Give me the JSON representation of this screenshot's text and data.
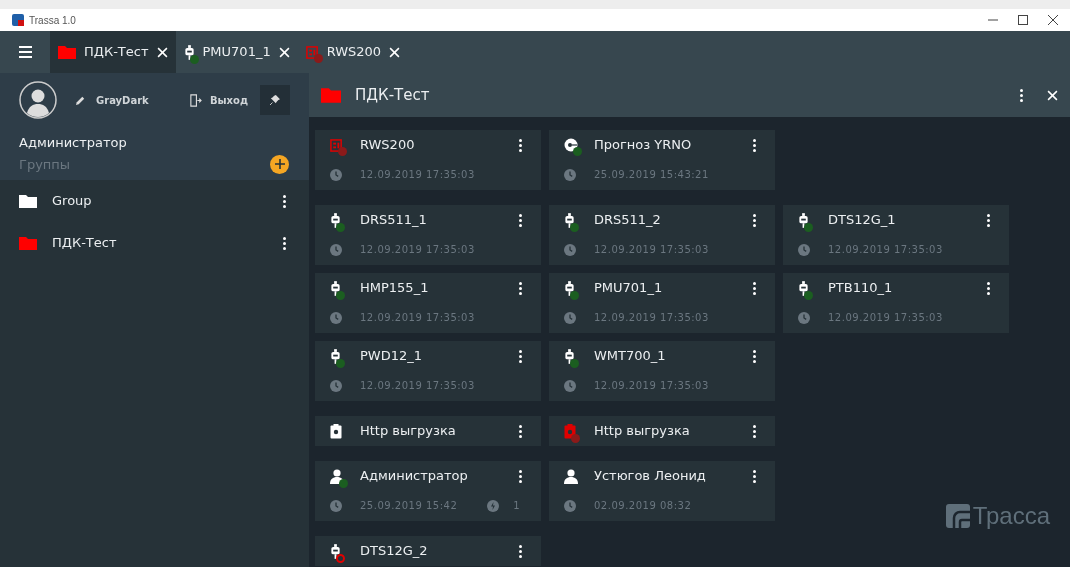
{
  "window": {
    "title": "Trassa 1.0"
  },
  "tabs": [
    {
      "label": "ПДК-Тест",
      "kind": "folder",
      "alarm": false,
      "selected": true
    },
    {
      "label": "PMU701_1",
      "kind": "device",
      "alarm": false,
      "color": "#1b5e20",
      "selected": false
    },
    {
      "label": "RWS200",
      "kind": "server",
      "alarm": true,
      "color": "#8b1a1a",
      "selected": false
    }
  ],
  "sidebar": {
    "theme": "GrayDark",
    "logout": "Выход",
    "pinned": true,
    "user": "Администратор",
    "groups_label": "Группы",
    "groups": [
      {
        "label": "Group",
        "color": "#ffffff"
      },
      {
        "label": "ПДК-Тест",
        "color": "#ff0000"
      }
    ]
  },
  "panel": {
    "title": "ПДК-Тест",
    "logo": "Трасса",
    "sections": [
      [
        {
          "kind": "server",
          "alarm": true,
          "disabled": false,
          "color": "#8b1a1a",
          "name": "RWS200",
          "time": "12.09.2019 17:35:03"
        },
        {
          "kind": "forecast",
          "alarm": false,
          "disabled": false,
          "color": "#1b5e20",
          "name": "Прогноз YRNO",
          "time": "25.09.2019 15:43:21"
        }
      ],
      [
        {
          "kind": "device",
          "alarm": false,
          "disabled": false,
          "color": "#1b5e20",
          "name": "DRS511_1",
          "time": "12.09.2019 17:35:03"
        },
        {
          "kind": "device",
          "alarm": false,
          "disabled": false,
          "color": "#1b5e20",
          "name": "DRS511_2",
          "time": "12.09.2019 17:35:03"
        },
        {
          "kind": "device",
          "alarm": false,
          "disabled": false,
          "color": "#1b5e20",
          "name": "DTS12G_1",
          "time": "12.09.2019 17:35:03"
        },
        {
          "kind": "device",
          "alarm": false,
          "disabled": false,
          "color": "#1b5e20",
          "name": "HMP155_1",
          "time": "12.09.2019 17:35:03"
        },
        {
          "kind": "device",
          "alarm": false,
          "disabled": false,
          "color": "#1b5e20",
          "name": "PMU701_1",
          "time": "12.09.2019 17:35:03"
        },
        {
          "kind": "device",
          "alarm": false,
          "disabled": false,
          "color": "#1b5e20",
          "name": "PTB110_1",
          "time": "12.09.2019 17:35:03"
        },
        {
          "kind": "device",
          "alarm": false,
          "disabled": false,
          "color": "#1b5e20",
          "name": "PWD12_1",
          "time": "12.09.2019 17:35:03"
        },
        {
          "kind": "device",
          "alarm": false,
          "disabled": false,
          "color": "#1b5e20",
          "name": "WMT700_1",
          "time": "12.09.2019 17:35:03"
        }
      ],
      [
        {
          "kind": "upload",
          "alarm": false,
          "disabled": false,
          "name": "Http выгрузка"
        },
        {
          "kind": "upload",
          "alarm": true,
          "disabled": false,
          "color": "#8b1a1a",
          "name": "Http выгрузка"
        }
      ],
      [
        {
          "kind": "user",
          "alarm": false,
          "disabled": false,
          "color": "#1b5e20",
          "name": "Администратор",
          "time": "25.09.2019 15:42",
          "count": "1"
        },
        {
          "kind": "user",
          "alarm": false,
          "disabled": false,
          "name": "Устюгов Леонид",
          "time": "02.09.2019 08:32"
        }
      ],
      [
        {
          "kind": "device",
          "alarm": false,
          "disabled": true,
          "name": "DTS12G_2"
        }
      ]
    ]
  }
}
